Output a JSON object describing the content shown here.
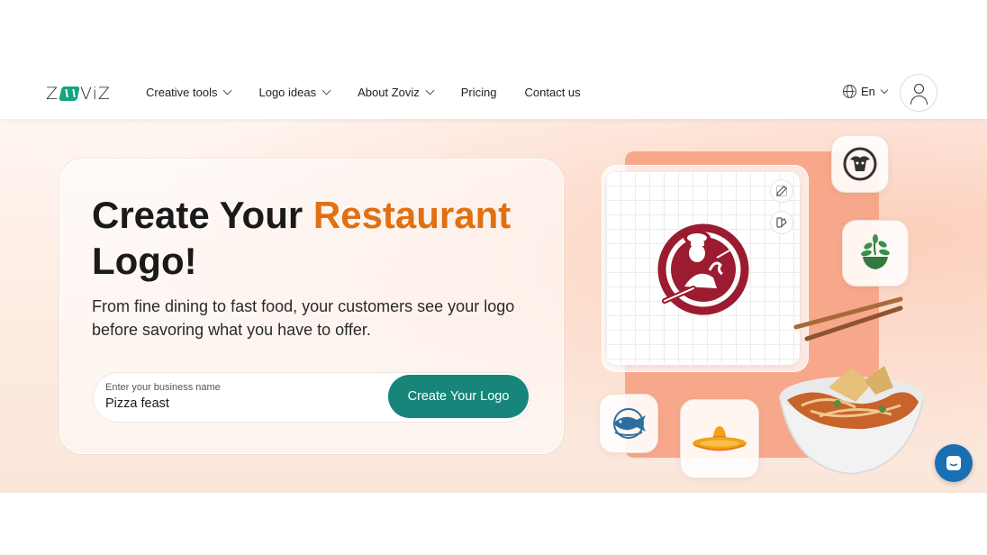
{
  "header": {
    "brand": "ZOVIZ",
    "nav": [
      {
        "label": "Creative tools",
        "dropdown": true
      },
      {
        "label": "Logo ideas",
        "dropdown": true
      },
      {
        "label": "About Zoviz",
        "dropdown": true
      },
      {
        "label": "Pricing",
        "dropdown": false
      },
      {
        "label": "Contact us",
        "dropdown": false
      }
    ],
    "language": "En",
    "user_icon": "user-icon"
  },
  "hero": {
    "title_start": "Create Your ",
    "title_accent": "Restaurant",
    "title_end": "Logo!",
    "subtitle": "From fine dining to fast food, your customers see your logo before savoring what you have to offer.",
    "input_label": "Enter your business name",
    "input_value": "Pizza feast",
    "cta_label": "Create Your Logo"
  },
  "colors": {
    "accent": "#e07012",
    "button": "#17857a",
    "brand_mark": "#17a57d",
    "chat": "#1a6fb3",
    "chef_logo": "#9b1b30"
  },
  "illustration": {
    "tiles": [
      "bull-logo-icon",
      "plant-bowl-logo-icon",
      "fish-logo-icon",
      "sombrero-logo-icon"
    ],
    "tools": [
      "edit-icon",
      "palette-icon"
    ]
  },
  "chat_icon": "chat-icon"
}
